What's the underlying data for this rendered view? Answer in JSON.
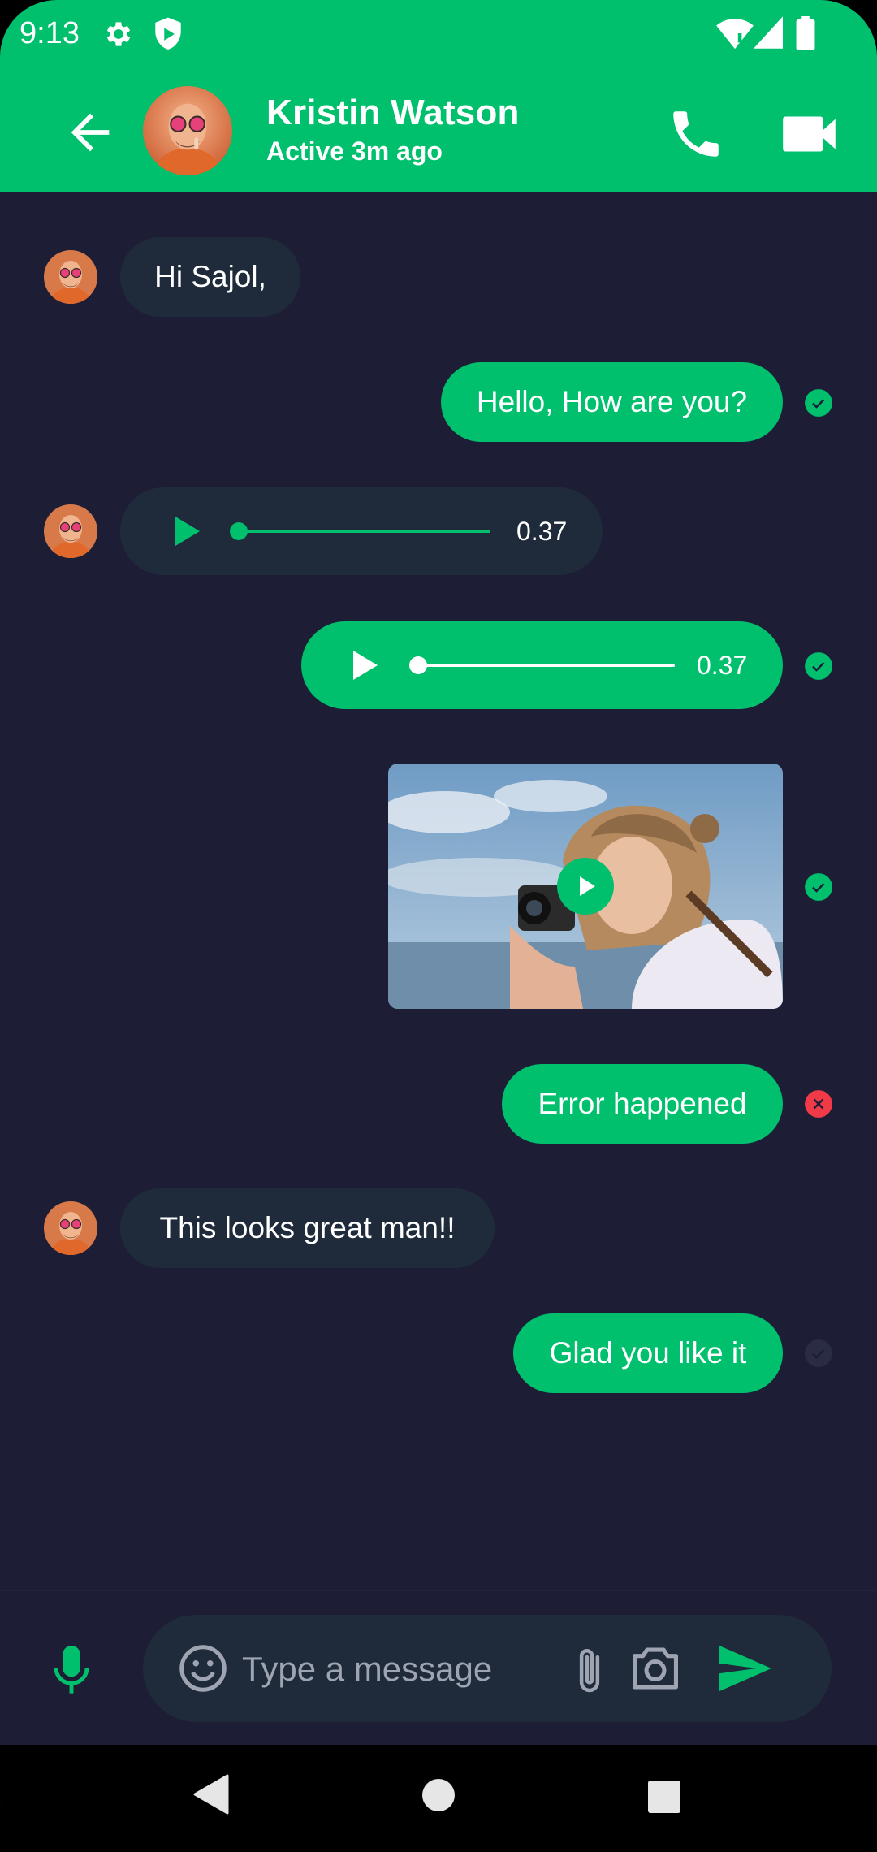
{
  "status_bar": {
    "time": "9:13"
  },
  "header": {
    "contact_name": "Kristin Watson",
    "contact_status": "Active 3m ago",
    "accent": "#00bf6d"
  },
  "messages": [
    {
      "direction": "incoming",
      "type": "text",
      "text": "Hi Sajol,"
    },
    {
      "direction": "outgoing",
      "type": "text",
      "text": "Hello, How are you?",
      "status": "sent"
    },
    {
      "direction": "incoming",
      "type": "audio",
      "duration": "0.37",
      "progress": 0
    },
    {
      "direction": "outgoing",
      "type": "audio",
      "duration": "0.37",
      "progress": 0,
      "status": "sent"
    },
    {
      "direction": "outgoing",
      "type": "video",
      "status": "sent"
    },
    {
      "direction": "outgoing",
      "type": "text",
      "text": "Error happened",
      "status": "error"
    },
    {
      "direction": "incoming",
      "type": "text",
      "text": "This looks great man!!"
    },
    {
      "direction": "outgoing",
      "type": "text",
      "text": "Glad you like it",
      "status": "not_viewed"
    }
  ],
  "composer": {
    "placeholder": "Type a message"
  },
  "colors": {
    "background": "#1d1e36",
    "incoming_bubble": "#1f2b3a",
    "outgoing_bubble": "#00bf6d",
    "error": "#f03a47"
  }
}
